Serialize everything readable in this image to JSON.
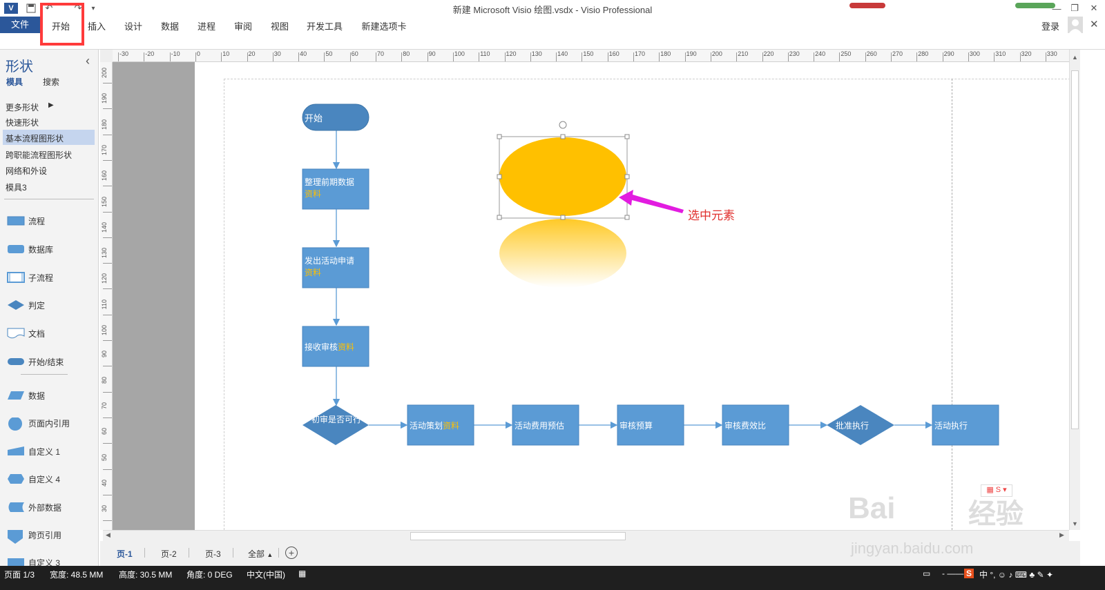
{
  "window": {
    "title": "新建 Microsoft Visio 绘图.vsdx - Visio Professional",
    "app_icon": "V",
    "signin": "登录"
  },
  "ribbon": {
    "file": "文件",
    "tabs": [
      "开始",
      "插入",
      "设计",
      "数据",
      "进程",
      "审阅",
      "视图",
      "开发工具",
      "新建选项卡"
    ]
  },
  "shapes_pane": {
    "title": "形状",
    "collapse": "‹",
    "subtabs": [
      "模具",
      "搜索"
    ],
    "menu": [
      "更多形状",
      "快速形状",
      "基本流程图形状",
      "跨职能流程图形状",
      "网络和外设",
      "模具3"
    ],
    "selected_menu_index": 2,
    "stencils": [
      "流程",
      "数据库",
      "子流程",
      "判定",
      "文档",
      "开始/结束",
      "数据",
      "页面内引用",
      "自定义 1",
      "自定义 4",
      "外部数据",
      "跨页引用",
      "自定义 3"
    ]
  },
  "ruler": {
    "h_labels": [
      "-30",
      "-20",
      "-10",
      "0",
      "10",
      "20",
      "30",
      "40",
      "50",
      "60",
      "70",
      "80",
      "90",
      "100",
      "110",
      "120",
      "130",
      "140",
      "150",
      "160",
      "170",
      "180",
      "190",
      "200",
      "210",
      "220",
      "230",
      "240",
      "250",
      "260",
      "270",
      "280",
      "290",
      "300",
      "310",
      "320",
      "330"
    ],
    "v_labels": [
      "200",
      "190",
      "180",
      "170",
      "160",
      "150",
      "140",
      "130",
      "120",
      "110",
      "100",
      "90",
      "80",
      "70",
      "60",
      "50",
      "40",
      "30"
    ]
  },
  "diagram": {
    "start": "开始",
    "steps": [
      {
        "text": "整理前期数据",
        "highlight": "资料"
      },
      {
        "text": "发出活动申请",
        "highlight": "资料"
      },
      {
        "text": "接收审核",
        "highlight": "资料"
      }
    ],
    "decision1": "初审是否可行",
    "row": [
      {
        "text": "活动策划",
        "highlight": "资料"
      },
      {
        "text": "活动费用预估",
        "highlight": ""
      },
      {
        "text": "审核预算",
        "highlight": ""
      },
      {
        "text": "审核费效比",
        "highlight": ""
      }
    ],
    "decision2": "批准执行",
    "end": "活动执行",
    "annotation": "选中元素",
    "colors": {
      "shape": "#5b9bd5",
      "shape_dark": "#4a86bf",
      "highlight": "#ffc000",
      "ellipse": "#ffc000",
      "arrow": "#e21ce0",
      "annotation": "#e0302d"
    }
  },
  "pages": {
    "tabs": [
      "页-1",
      "页-2",
      "页-3"
    ],
    "all": "全部",
    "active": 0
  },
  "status": {
    "page": "页面 1/3",
    "width": "宽度: 48.5 MM",
    "height": "高度: 30.5 MM",
    "angle": "角度: 0 DEG",
    "language": "中文(中国)"
  },
  "watermark": {
    "text1": "Bai",
    "text2": "经验",
    "url": "jingyan.baidu.com"
  }
}
